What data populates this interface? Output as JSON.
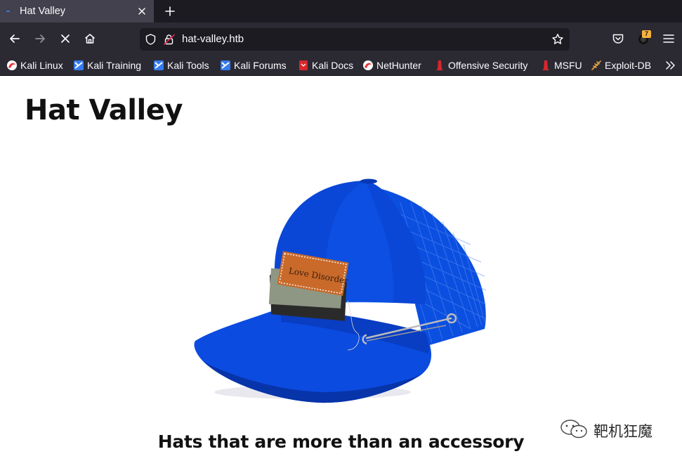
{
  "colors": {
    "tabstrip_bg": "#1c1b22",
    "active_tab_bg": "#42414d",
    "toolbar_bg": "#2b2a33",
    "urlbar_bg": "#1c1b22",
    "toolbar_text": "#fbfbfe",
    "badge_bg": "#f6b23c",
    "hat_blue": "#0a47d6",
    "page_bg": "#ffffff"
  },
  "tab": {
    "title": "Hat Valley",
    "favicon": "firefox-loading-dot-icon"
  },
  "navbar": {
    "back_icon": "back-arrow-icon",
    "forward_icon": "forward-arrow-icon",
    "stop_icon": "stop-loading-icon",
    "home_icon": "home-icon",
    "url": "hat-valley.htb",
    "extension_badge": "7"
  },
  "bookmarks": [
    {
      "label": "Kali Linux",
      "icon": "kali-dragon-icon"
    },
    {
      "label": "Kali Training",
      "icon": "kali-training-icon"
    },
    {
      "label": "Kali Tools",
      "icon": "kali-tools-icon"
    },
    {
      "label": "Kali Forums",
      "icon": "kali-forums-icon"
    },
    {
      "label": "Kali Docs",
      "icon": "kali-docs-icon"
    },
    {
      "label": "NetHunter",
      "icon": "nethunter-icon"
    },
    {
      "label": "Offensive Security",
      "icon": "offsec-icon"
    },
    {
      "label": "MSFU",
      "icon": "msfu-icon"
    },
    {
      "label": "Exploit-DB",
      "icon": "exploit-db-icon"
    }
  ],
  "page": {
    "title": "Hat Valley",
    "hero_image": "blue-trucker-cap-image",
    "hat_patch_text": "Love Disorder",
    "tagline": "Hats that are more than an accessory"
  },
  "watermark": {
    "text": "靶机狂魔",
    "icon": "wechat-icon"
  }
}
